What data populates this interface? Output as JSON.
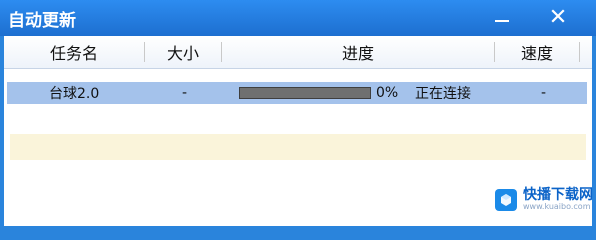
{
  "window": {
    "title": "自动更新",
    "minimize_icon": "minimize-icon",
    "close_icon": "close-icon",
    "accent": "#2a84dc"
  },
  "table": {
    "columns": [
      "任务名",
      "大小",
      "进度",
      "速度"
    ],
    "rows": [
      {
        "name": "台球2.0",
        "size": "-",
        "progress": 0,
        "progress_text": "0%",
        "status": "正在连接",
        "speed": "-"
      }
    ]
  },
  "watermark": {
    "name": "快播下载网",
    "url": "www.kuaibo.com"
  }
}
